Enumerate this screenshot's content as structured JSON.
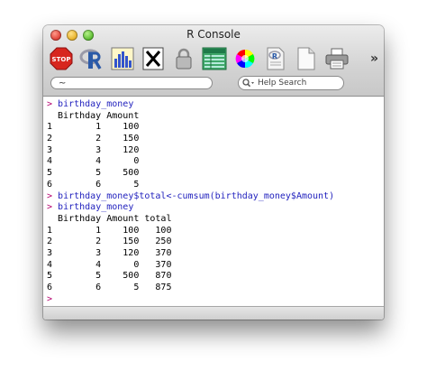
{
  "window": {
    "title": "R Console"
  },
  "toolbar": {
    "stop_label": "STOP",
    "overflow": "»",
    "buttons": [
      "stop-icon",
      "r-logo-icon",
      "chart-icon",
      "x11-icon",
      "lock-icon",
      "data-table-icon",
      "color-wheel-icon",
      "source-script-icon",
      "new-document-icon",
      "printer-icon"
    ]
  },
  "path": {
    "value": "~"
  },
  "search": {
    "placeholder": "Help Search"
  },
  "console": {
    "lines": [
      {
        "prompt": "> ",
        "text": "birthday_money",
        "type": "cmd"
      },
      {
        "prompt": "",
        "text": "  Birthday Amount",
        "type": "out"
      },
      {
        "prompt": "",
        "text": "1        1    100",
        "type": "out"
      },
      {
        "prompt": "",
        "text": "2        2    150",
        "type": "out"
      },
      {
        "prompt": "",
        "text": "3        3    120",
        "type": "out"
      },
      {
        "prompt": "",
        "text": "4        4      0",
        "type": "out"
      },
      {
        "prompt": "",
        "text": "5        5    500",
        "type": "out"
      },
      {
        "prompt": "",
        "text": "6        6      5",
        "type": "out"
      },
      {
        "prompt": "> ",
        "text": "birthday_money$total<-cumsum(birthday_money$Amount)",
        "type": "cmd"
      },
      {
        "prompt": "> ",
        "text": "birthday_money",
        "type": "cmd"
      },
      {
        "prompt": "",
        "text": "  Birthday Amount total",
        "type": "out"
      },
      {
        "prompt": "",
        "text": "1        1    100   100",
        "type": "out"
      },
      {
        "prompt": "",
        "text": "2        2    150   250",
        "type": "out"
      },
      {
        "prompt": "",
        "text": "3        3    120   370",
        "type": "out"
      },
      {
        "prompt": "",
        "text": "4        4      0   370",
        "type": "out"
      },
      {
        "prompt": "",
        "text": "5        5    500   870",
        "type": "out"
      },
      {
        "prompt": "",
        "text": "6        6      5   875",
        "type": "out"
      },
      {
        "prompt": "> ",
        "text": "",
        "type": "cmd"
      }
    ]
  }
}
